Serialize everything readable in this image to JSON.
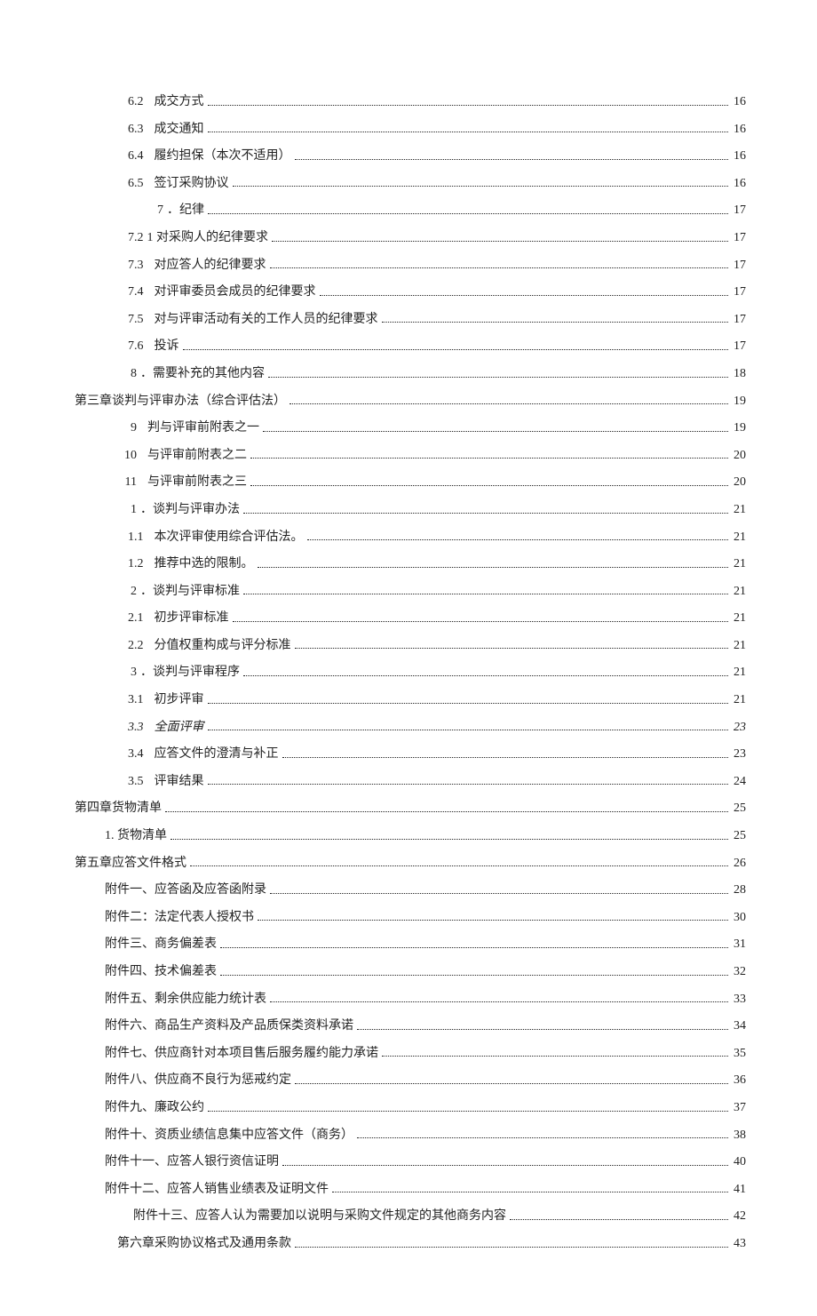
{
  "toc": [
    {
      "indent": "indent-3",
      "num": "6.2",
      "text": "成交方式",
      "page": "16"
    },
    {
      "indent": "indent-3",
      "num": "6.3",
      "text": "成交通知",
      "page": "16"
    },
    {
      "indent": "indent-3",
      "num": "6.4",
      "text": "履约担保（本次不适用）",
      "page": "16"
    },
    {
      "indent": "indent-3",
      "num": "6.5",
      "text": "签订采购协议",
      "page": "16"
    },
    {
      "indent": "indent-2",
      "num": "7",
      "numClass": "w2",
      "text": "．纪律",
      "nogap": true,
      "page": "17"
    },
    {
      "indent": "indent-3",
      "num": "7.2",
      "text": "1 对采购人的纪律要求",
      "nogap": true,
      "page": "17"
    },
    {
      "indent": "indent-3",
      "num": "7.3",
      "text": "对应答人的纪律要求",
      "page": "17"
    },
    {
      "indent": "indent-3",
      "num": "7.4",
      "text": "对评审委员会成员的纪律要求",
      "page": "17"
    },
    {
      "indent": "indent-3",
      "num": "7.5",
      "text": "对与评审活动有关的工作人员的纪律要求",
      "page": "17"
    },
    {
      "indent": "indent-3",
      "num": "7.6",
      "text": "投诉",
      "page": "17"
    },
    {
      "indent": "indent-1",
      "num": "8",
      "numClass": "w2",
      "text": "．需要补充的其他内容",
      "nogap": true,
      "page": "18"
    },
    {
      "indent": "indent-0",
      "num": "",
      "text": "第三章谈判与评审办法（综合评估法）",
      "nogap": true,
      "page": "19"
    },
    {
      "indent": "indent-1",
      "num": "9",
      "numClass": "w2",
      "text": "判与评审前附表之一",
      "page": "19"
    },
    {
      "indent": "indent-1",
      "num": "10",
      "numClass": "w2",
      "text": "与评审前附表之二",
      "page": "20"
    },
    {
      "indent": "indent-1",
      "num": "11",
      "numClass": "w2",
      "text": "与评审前附表之三",
      "page": "20"
    },
    {
      "indent": "indent-1",
      "num": "1",
      "numClass": "w2",
      "text": "．谈判与评审办法",
      "nogap": true,
      "page": "21"
    },
    {
      "indent": "indent-3",
      "num": "1.1",
      "text": "本次评审使用综合评估法。",
      "page": "21"
    },
    {
      "indent": "indent-3",
      "num": "1.2",
      "text": "推荐中选的限制。",
      "page": "21"
    },
    {
      "indent": "indent-1",
      "num": "2",
      "numClass": "w2",
      "text": "．谈判与评审标准",
      "nogap": true,
      "page": "21"
    },
    {
      "indent": "indent-3",
      "num": "2.1",
      "text": "初步评审标准",
      "page": "21"
    },
    {
      "indent": "indent-3",
      "num": "2.2",
      "text": "分值权重构成与评分标准",
      "page": "21"
    },
    {
      "indent": "indent-1",
      "num": "3",
      "numClass": "w2",
      "text": "．谈判与评审程序",
      "nogap": true,
      "page": "21"
    },
    {
      "indent": "indent-3",
      "num": "3.1",
      "text": "初步评审",
      "page": "21"
    },
    {
      "indent": "indent-3",
      "num": "3.3",
      "text": "全面评审",
      "page": "23",
      "italic": true
    },
    {
      "indent": "indent-3",
      "num": "3.4",
      "text": "应答文件的澄清与补正",
      "page": "23"
    },
    {
      "indent": "indent-3",
      "num": "3.5",
      "text": "评审结果",
      "page": "24"
    },
    {
      "indent": "indent-0",
      "num": "",
      "text": "第四章货物清单",
      "nogap": true,
      "page": "25"
    },
    {
      "indent": "indent-1b",
      "num": "",
      "text": "1. 货物清单",
      "nogap": true,
      "page": "25"
    },
    {
      "indent": "indent-0",
      "num": "",
      "text": "第五章应答文件格式",
      "nogap": true,
      "page": "26"
    },
    {
      "indent": "indent-att",
      "num": "",
      "text": "附件一、应答函及应答函附录",
      "nogap": true,
      "page": "28"
    },
    {
      "indent": "indent-att",
      "num": "",
      "text": "附件二：法定代表人授权书",
      "nogap": true,
      "page": "30"
    },
    {
      "indent": "indent-att",
      "num": "",
      "text": "附件三、商务偏差表",
      "nogap": true,
      "page": "31"
    },
    {
      "indent": "indent-att",
      "num": "",
      "text": "附件四、技术偏差表",
      "nogap": true,
      "page": "32"
    },
    {
      "indent": "indent-att",
      "num": "",
      "text": "附件五、剩余供应能力统计表",
      "nogap": true,
      "page": "33"
    },
    {
      "indent": "indent-att",
      "num": "",
      "text": "附件六、商品生产资料及产品质保类资料承诺",
      "nogap": true,
      "page": "34"
    },
    {
      "indent": "indent-att",
      "num": "",
      "text": "附件七、供应商针对本项目售后服务履约能力承诺",
      "nogap": true,
      "page": "35"
    },
    {
      "indent": "indent-att",
      "num": "",
      "text": "附件八、供应商不良行为惩戒约定",
      "nogap": true,
      "page": "36"
    },
    {
      "indent": "indent-att",
      "num": "",
      "text": "附件九、廉政公约",
      "nogap": true,
      "page": "37"
    },
    {
      "indent": "indent-att",
      "num": "",
      "text": "附件十、资质业绩信息集中应答文件（商务）",
      "nogap": true,
      "page": "38"
    },
    {
      "indent": "indent-att",
      "num": "",
      "text": "附件十一、应答人银行资信证明",
      "nogap": true,
      "page": "40"
    },
    {
      "indent": "indent-att",
      "num": "",
      "text": "附件十二、应答人销售业绩表及证明文件",
      "nogap": true,
      "page": "41"
    },
    {
      "indent": "indent-att2",
      "num": "",
      "text": "附件十三、应答人认为需要加以说明与采购文件规定的其他商务内容",
      "nogap": true,
      "page": "42"
    },
    {
      "indent": "indent-ch6",
      "num": "",
      "text": "第六章采购协议格式及通用条款",
      "nogap": true,
      "page": "43"
    }
  ]
}
